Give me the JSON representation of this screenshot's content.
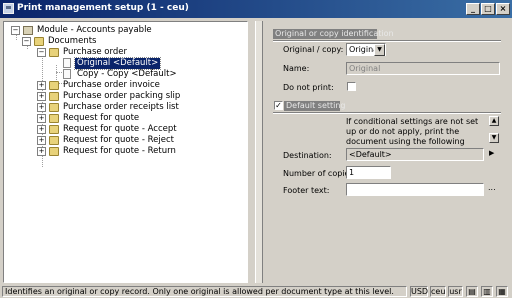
{
  "window": {
    "title": "Print management setup (1 - ceu)",
    "buttons": [
      "_",
      "□",
      "×"
    ]
  },
  "tree": {
    "root": "Module - Accounts payable",
    "documents": "Documents",
    "purchase_order": "Purchase order",
    "original": "Original <Default>",
    "copy": "Copy - Copy <Default>",
    "items": [
      "Purchase order invoice",
      "Purchase order packing slip",
      "Purchase order receipts list",
      "Request for quote",
      "Request for quote - Accept",
      "Request for quote - Reject",
      "Request for quote - Return"
    ]
  },
  "identification": {
    "header": "Original or copy identification",
    "original_copy_label": "Original / copy:",
    "original_copy_value": "Original",
    "name_label": "Name:",
    "name_value": "Original",
    "do_not_print_label": "Do not print:"
  },
  "default_setting": {
    "header": "Default setting",
    "info": "If conditional settings are not set up or do not apply, print the document using the following setting.",
    "destination_label": "Destination:",
    "destination_value": "<Default>",
    "copies_label": "Number of copies:",
    "copies_value": "1",
    "footer_label": "Footer text:",
    "footer_value": "",
    "footer_button": "..."
  },
  "status": {
    "text": "Identifies an original or copy record. Only one original is allowed per document type at this level.",
    "currency": "USD",
    "company": "ceu",
    "user": "usr"
  }
}
